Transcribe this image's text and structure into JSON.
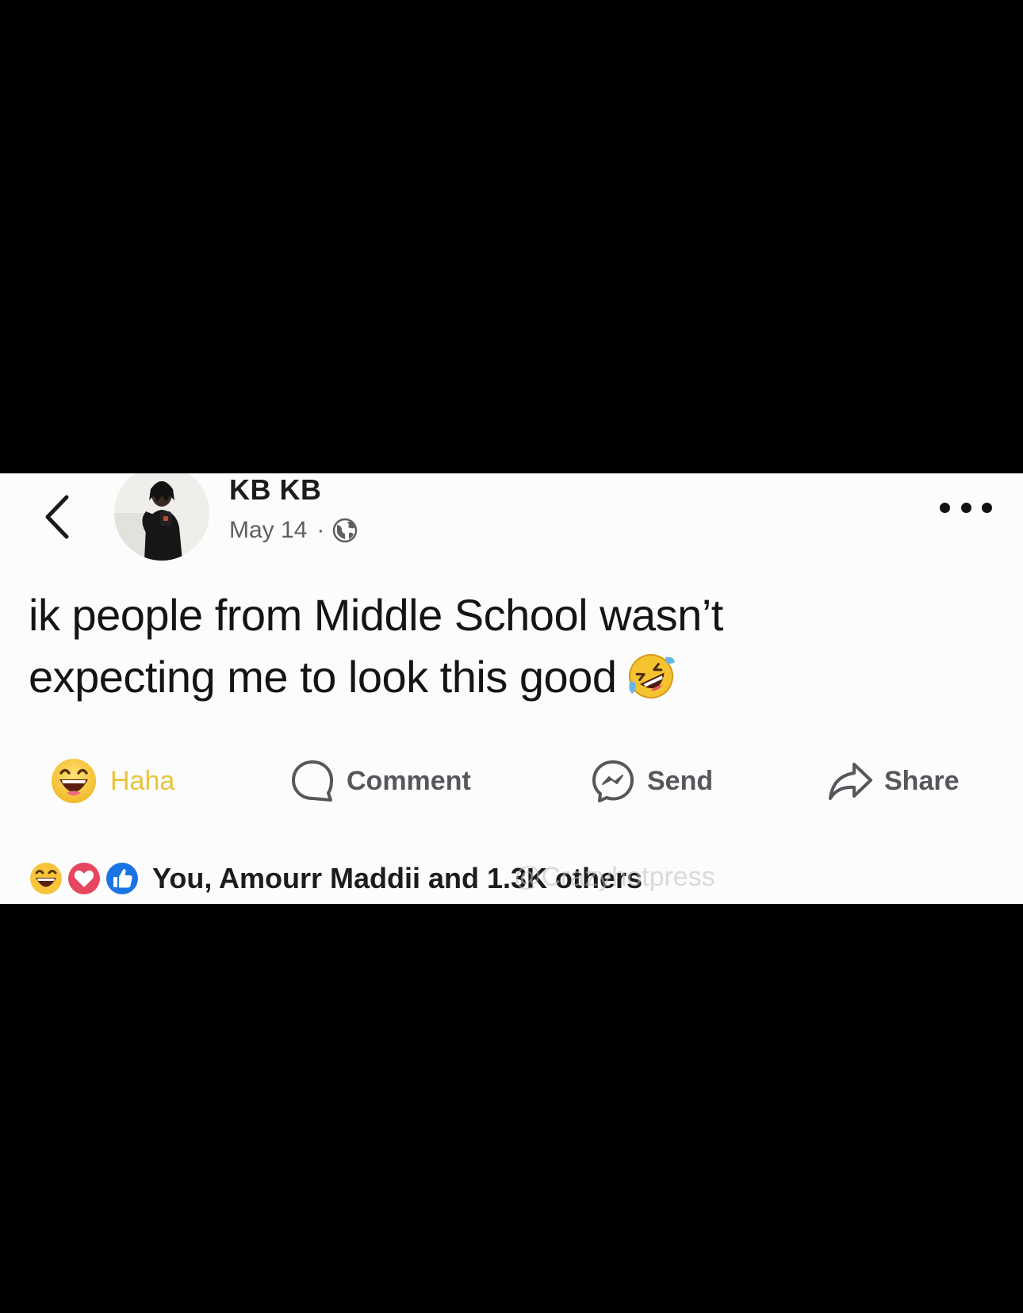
{
  "header": {
    "back_icon": "chevron-left-icon",
    "author_name": "KB KB",
    "date": "May 14",
    "separator": "·",
    "privacy_icon": "globe-icon",
    "more_icon": "more-horizontal-icon"
  },
  "post": {
    "text_line_1": "ik people from Middle School wasn’t",
    "text_line_2": "expecting me to look this good",
    "emoji": "rolling-on-floor-laughing-emoji"
  },
  "actions": [
    {
      "label": "Haha",
      "icon": "haha-reaction-icon",
      "color": "#e9c43a"
    },
    {
      "label": "Comment",
      "icon": "comment-icon"
    },
    {
      "label": "Send",
      "icon": "messenger-icon"
    },
    {
      "label": "Share",
      "icon": "share-icon"
    }
  ],
  "reactions": {
    "icons": [
      "haha-reaction-icon",
      "love-reaction-icon",
      "like-reaction-icon"
    ],
    "summary_text": "You, Amourr Maddii and 1.3K others"
  },
  "watermark": "@Crazyhotpress",
  "colors": {
    "card_background": "#fcfcfc",
    "letterbox": "#000000",
    "haha_yellow": "#e9c43a",
    "love_red": "#e8455f",
    "like_blue": "#1b74e4",
    "muted_text": "#5d5f63"
  }
}
